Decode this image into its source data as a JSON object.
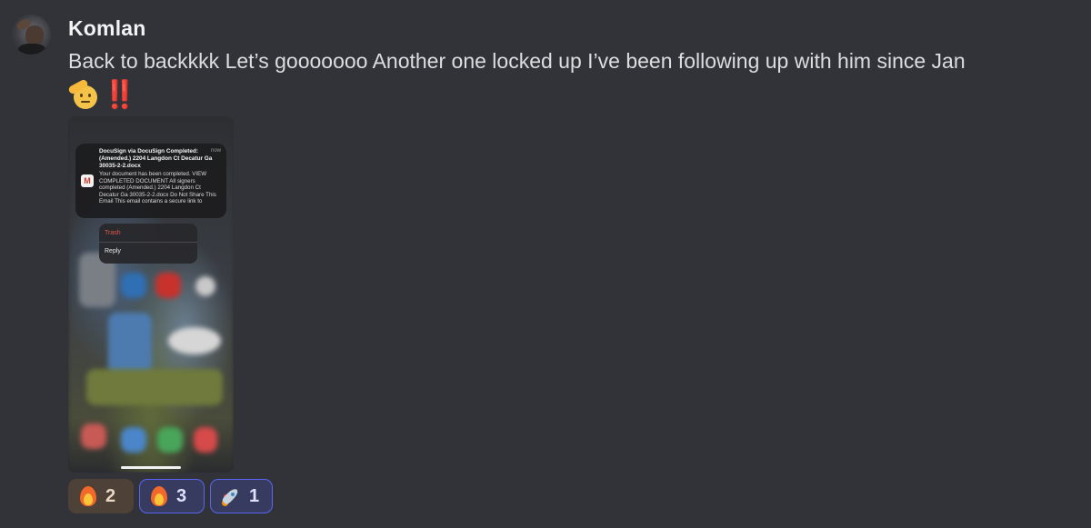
{
  "message": {
    "author": "Komlan",
    "text": "Back to backkkk Let’s gooooooo Another one locked up I’ve been following up with him since Jan",
    "emoji_line": [
      "saluting-face",
      "double-exclamation-mark"
    ],
    "double_exclamation": "‼️"
  },
  "attachment": {
    "notification": {
      "title": "DocuSign via DocuSign Completed: (Amended.) 2204 Langdon Ct Decatur Ga 30035-2-2.docx",
      "time": "now",
      "body": "Your document has been completed. VIEW COMPLETED DOCUMENT All signers completed (Amended.) 2204 Langdon Ct Decatur Ga 30035-2-2.docx Do Not Share This Email This email contains a secure link to",
      "app_icon": "gmail-icon",
      "app_icon_letter": "M"
    },
    "menu": {
      "trash": "Trash",
      "reply": "Reply"
    }
  },
  "reactions": [
    {
      "emoji": "fire-icon",
      "count": "2",
      "selected": false
    },
    {
      "emoji": "fire-icon",
      "count": "3",
      "selected": true
    },
    {
      "emoji": "rocket-icon",
      "count": "1",
      "selected": true
    }
  ],
  "colors": {
    "background": "#313338",
    "username": "#f2f3f5",
    "text": "#dbdee1",
    "selected_reaction_border": "#5865f2",
    "selected_reaction_bg": "#363b5f",
    "reaction_bg": "#4e4137"
  }
}
